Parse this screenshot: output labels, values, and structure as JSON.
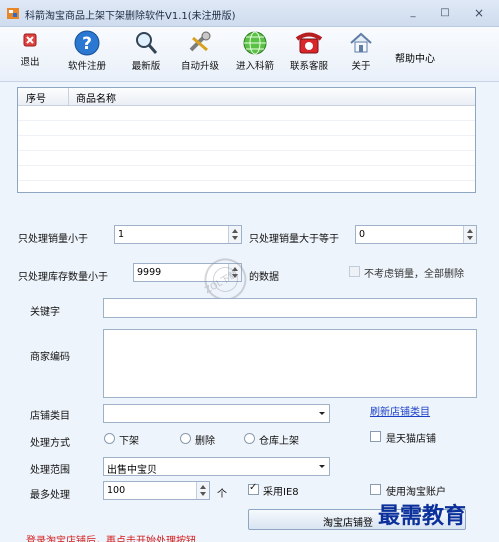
{
  "window": {
    "title": "科箭淘宝商品上架下架删除软件V1.1(未注册版)",
    "minimize_glyph": "_",
    "maximize_glyph": "□",
    "close_glyph": "×"
  },
  "toolbar": {
    "items": [
      {
        "label": "退出",
        "icon": "exit-icon"
      },
      {
        "label": "软件注册",
        "icon": "help-icon"
      },
      {
        "label": "最新版",
        "icon": "magnifier-icon"
      },
      {
        "label": "自动升级",
        "icon": "wrench-icon"
      },
      {
        "label": "进入科箭",
        "icon": "globe-icon"
      },
      {
        "label": "联系客服",
        "icon": "phone-icon"
      },
      {
        "label": "关于",
        "icon": "home-icon"
      }
    ],
    "help_label": "帮助中心"
  },
  "grid": {
    "columns": [
      "序号",
      "商品名称"
    ],
    "rows": []
  },
  "filters": {
    "sales_less_label": "只处理销量小于",
    "sales_less_value": "1",
    "sales_more_label": "只处理销量大于等于",
    "sales_more_value": "0",
    "stock_less_label": "只处理库存数量小于",
    "stock_less_value": "9999",
    "stock_suffix": "的数据",
    "ignore_sales_label": "不考虑销量，全部删除"
  },
  "form": {
    "keyword_label": "关键字",
    "keyword_value": "",
    "merchant_code_label": "商家编码",
    "merchant_code_value": "",
    "store_category_label": "店铺类目",
    "store_category_value": "",
    "refresh_category_link": "刷新店铺类目",
    "action_mode_label": "处理方式",
    "action_options": [
      "下架",
      "删除",
      "仓库上架"
    ],
    "tmall_label": "是天猫店铺",
    "range_label": "处理范围",
    "range_value": "出售中宝贝",
    "max_label": "最多处理",
    "max_value": "100",
    "max_unit": "个",
    "use_ie8_label": "采用IE8",
    "use_taobao_account_label": "使用淘宝账户",
    "login_button_label": "淘宝店铺登"
  },
  "notice": "登录淘宝店铺后，再点击开始处理按钮",
  "watermark_text": "ZOL下载",
  "overlay_brand": "最需教育"
}
